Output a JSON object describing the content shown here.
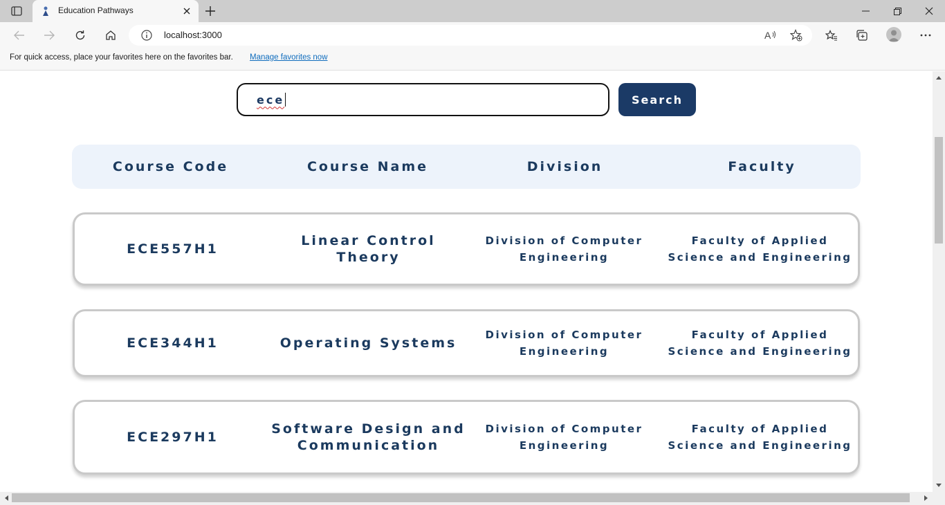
{
  "browser": {
    "tab_title": "Education Pathways",
    "url": "localhost:3000",
    "favorites_message": "For quick access, place your favorites here on the favorites bar.",
    "favorites_link": "Manage favorites now"
  },
  "search": {
    "value": "ece",
    "button_label": "Search"
  },
  "table": {
    "headers": [
      "Course Code",
      "Course Name",
      "Division",
      "Faculty"
    ],
    "rows": [
      {
        "code": "ECE557H1",
        "name_lines": [
          "Linear Control",
          "Theory"
        ],
        "division_lines": [
          "Division of Computer",
          "Engineering"
        ],
        "faculty_lines": [
          "Faculty of Applied",
          "Science and Engineering"
        ]
      },
      {
        "code": "ECE344H1",
        "name_lines": [
          "Operating Systems"
        ],
        "division_lines": [
          "Division of Computer",
          "Engineering"
        ],
        "faculty_lines": [
          "Faculty of Applied",
          "Science and Engineering"
        ]
      },
      {
        "code": "ECE297H1",
        "name_lines": [
          "Software Design and",
          "Communication"
        ],
        "division_lines": [
          "Division of Computer",
          "Engineering"
        ],
        "faculty_lines": [
          "Faculty of Applied",
          "Science and Engineering"
        ]
      }
    ]
  },
  "colors": {
    "primary_navy": "#1b3a66",
    "text_navy": "#1b3a5e",
    "header_bg": "#edf3fb",
    "card_border": "#c9c9c9"
  }
}
